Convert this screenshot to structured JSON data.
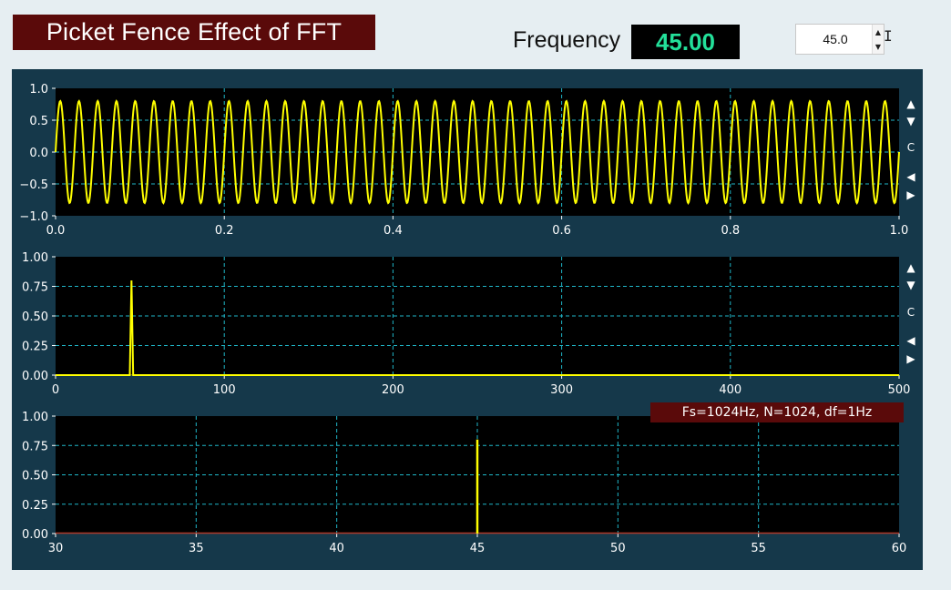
{
  "header": {
    "title": "Picket Fence Effect of FFT",
    "frequency_label": "Frequency",
    "frequency_display": "45.00",
    "spinbox_value": "45.0",
    "spinbox_up": "▲",
    "spinbox_down": "▼"
  },
  "toolbar_icons": {
    "up": "▲",
    "down": "▼",
    "reset": "C",
    "left": "◀",
    "right": "▶"
  },
  "info_label": "Fs=1024Hz, N=1024, df=1Hz",
  "colors": {
    "panel_bg": "#15384a",
    "plot_bg": "#000000",
    "signal": "#ffff00",
    "grid": "#1fb6c8",
    "title_bg": "#5a0a0a",
    "display_text": "#23e09a"
  },
  "chart_data": [
    {
      "type": "line",
      "series": [
        {
          "function": "0.8*sin(2*pi*45*t)",
          "frequency_hz": 45,
          "amplitude": 0.8
        }
      ],
      "xlim": [
        0.0,
        1.0
      ],
      "ylim": [
        -1.0,
        1.0
      ],
      "x_ticks": [
        "0.0",
        "0.2",
        "0.4",
        "0.6",
        "0.8",
        "1.0"
      ],
      "y_ticks": [
        "1.0",
        "0.5",
        "0.0",
        "−0.5",
        "−1.0"
      ],
      "grid": true
    },
    {
      "type": "line",
      "series": [
        {
          "x": [
            0,
            44,
            45,
            46,
            500
          ],
          "values": [
            0,
            0,
            0.8,
            0,
            0
          ]
        }
      ],
      "xlim": [
        0,
        500
      ],
      "ylim": [
        0.0,
        1.0
      ],
      "x_ticks": [
        "0",
        "100",
        "200",
        "300",
        "400",
        "500"
      ],
      "y_ticks": [
        "1.00",
        "0.75",
        "0.50",
        "0.25",
        "0.00"
      ],
      "grid": true
    },
    {
      "type": "bar",
      "series": [
        {
          "x": [
            45
          ],
          "values": [
            0.8
          ]
        }
      ],
      "xlim": [
        30,
        60
      ],
      "ylim": [
        0.0,
        1.0
      ],
      "x_ticks": [
        "30",
        "35",
        "40",
        "45",
        "50",
        "55",
        "60"
      ],
      "y_ticks": [
        "1.00",
        "0.75",
        "0.50",
        "0.25",
        "0.00"
      ],
      "grid": true
    }
  ]
}
